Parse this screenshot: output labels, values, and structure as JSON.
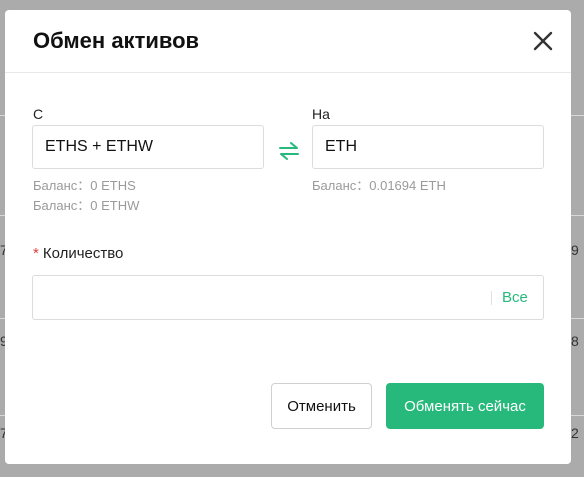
{
  "modal": {
    "title": "Обмен активов",
    "from": {
      "label": "С",
      "value": "ETHS + ETHW",
      "balances": [
        "Баланс：0 ETHS",
        "Баланс：0 ETHW"
      ]
    },
    "to": {
      "label": "На",
      "value": "ETH",
      "balances": [
        "Баланс：0.01694 ETH"
      ]
    },
    "amount": {
      "required_mark": "*",
      "label": "Количество",
      "value": "",
      "all_label": "Все"
    },
    "buttons": {
      "cancel": "Отменить",
      "submit": "Обменять сейчас"
    }
  },
  "background": {
    "edge_digits": [
      "7",
      "9",
      "9",
      "8",
      "7",
      "2"
    ]
  },
  "colors": {
    "accent": "#27b97b",
    "required": "#e0403c",
    "overlay": "#7f7f7f"
  },
  "icons": {
    "close": "close-icon",
    "swap": "swap-arrows-icon"
  }
}
